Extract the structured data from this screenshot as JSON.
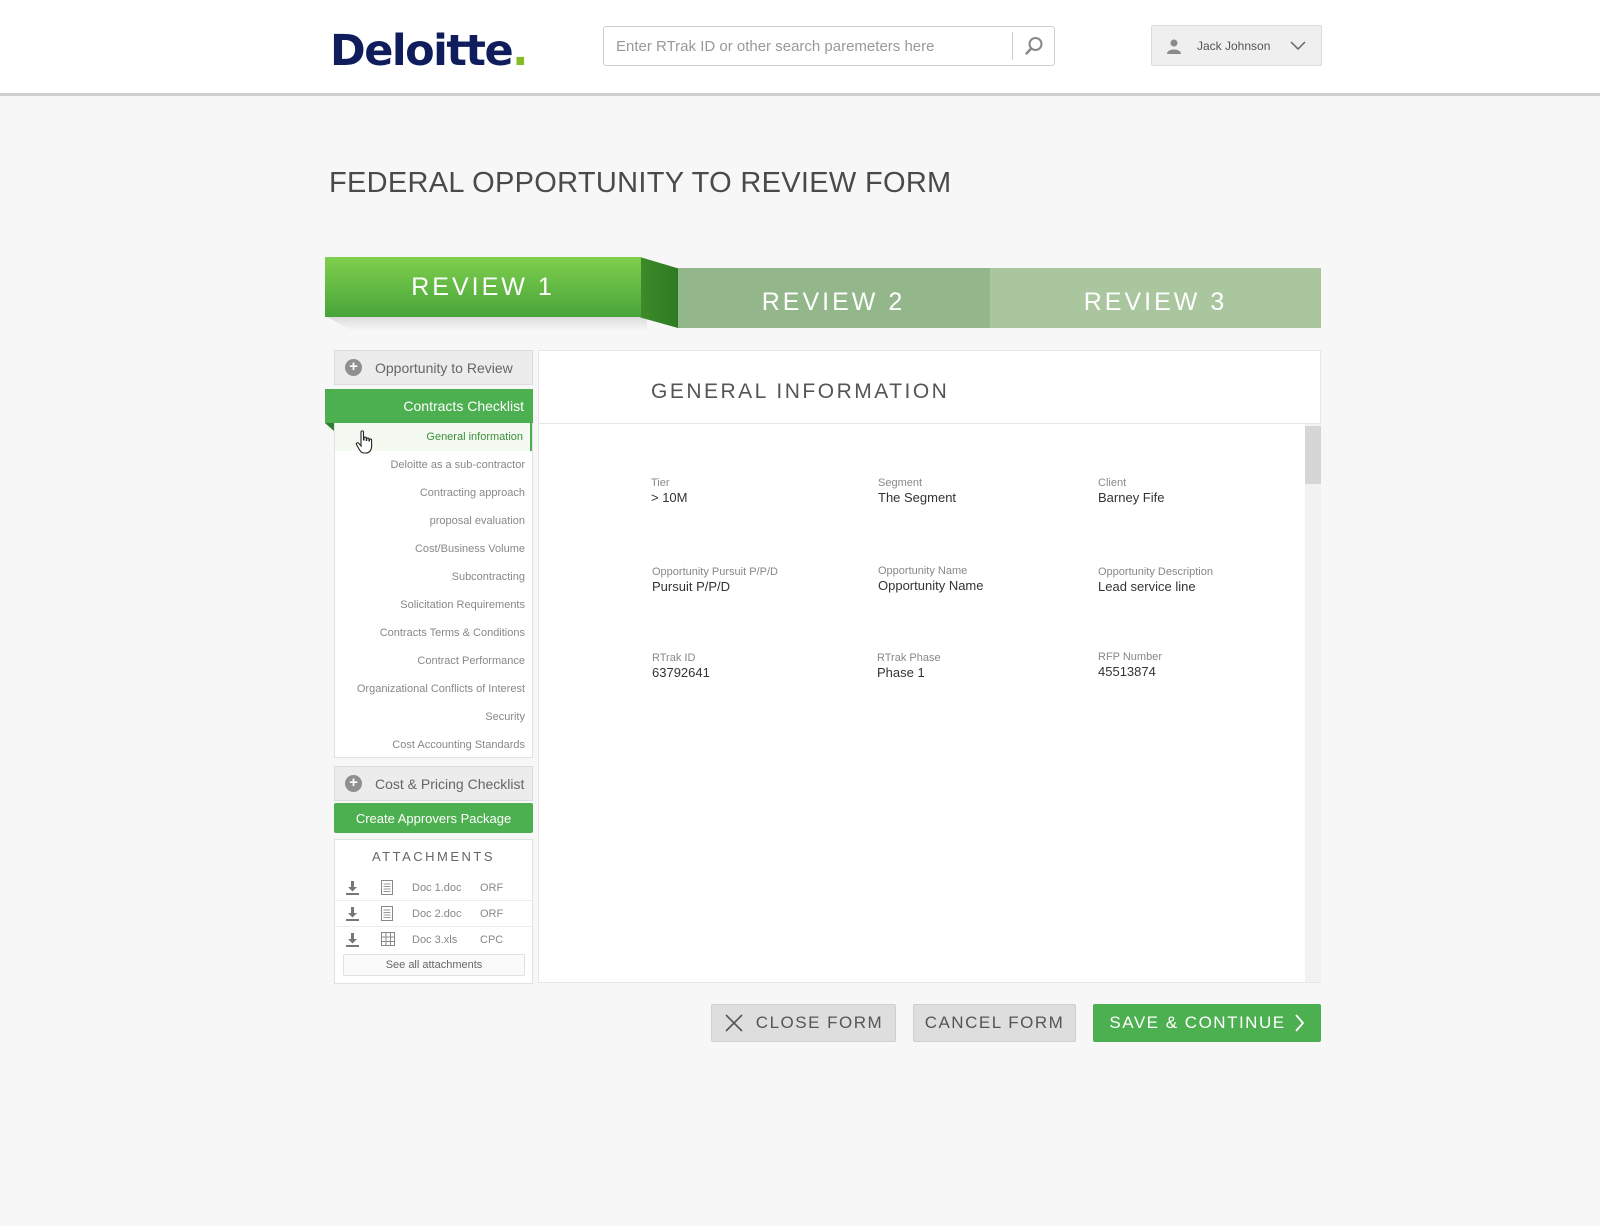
{
  "header": {
    "logo_text": "Deloitte",
    "logo_dot": ".",
    "search_placeholder": "Enter RTrak ID or other search paremeters here",
    "user_name": "Jack Johnson"
  },
  "page_title": "FEDERAL OPPORTUNITY TO REVIEW FORM",
  "review_tabs": [
    {
      "label": "REVIEW 1",
      "active": true
    },
    {
      "label": "REVIEW 2",
      "active": false
    },
    {
      "label": "REVIEW 3",
      "active": false
    }
  ],
  "sidebar": {
    "opportunity_label": "Opportunity to Review",
    "contracts_label": "Contracts Checklist",
    "items": [
      "General information",
      "Deloitte as a sub-contractor",
      "Contracting approach",
      "proposal evaluation",
      "Cost/Business Volume",
      "Subcontracting",
      "Solicitation Requirements",
      "Contracts Terms & Conditions",
      "Contract Performance",
      "Organizational Conflicts of Interest",
      "Security",
      "Cost Accounting Standards"
    ],
    "cost_pricing_label": "Cost & Pricing Checklist",
    "create_button": "Create Approvers Package"
  },
  "attachments": {
    "title": "ATTACHMENTS",
    "items": [
      {
        "name": "Doc 1.doc",
        "type": "ORF",
        "icon": "document-icon"
      },
      {
        "name": "Doc 2.doc",
        "type": "ORF",
        "icon": "document-icon"
      },
      {
        "name": "Doc 3.xls",
        "type": "CPC",
        "icon": "spreadsheet-icon"
      }
    ],
    "see_all": "See all attachments"
  },
  "panel": {
    "title": "GENERAL INFORMATION",
    "fields": [
      {
        "label": "Tier",
        "value": "> 10M"
      },
      {
        "label": "Segment",
        "value": "The Segment"
      },
      {
        "label": "Client",
        "value": "Barney Fife"
      },
      {
        "label": "Opportunity Pursuit P/P/D",
        "value": "Pursuit P/P/D"
      },
      {
        "label": "Opportunity Name",
        "value": "Opportunity Name"
      },
      {
        "label": "Opportunity Description",
        "value": "Lead service line"
      },
      {
        "label": "RTrak ID",
        "value": "63792641"
      },
      {
        "label": "RTrak Phase",
        "value": "Phase 1"
      },
      {
        "label": "RFP Number",
        "value": "45513874"
      }
    ]
  },
  "buttons": {
    "close": "CLOSE FORM",
    "cancel": "CANCEL FORM",
    "save": "SAVE & CONTINUE"
  },
  "colors": {
    "brand_navy": "#0f1d5c",
    "brand_green": "#86bc25",
    "accent_green": "#4caf50"
  }
}
